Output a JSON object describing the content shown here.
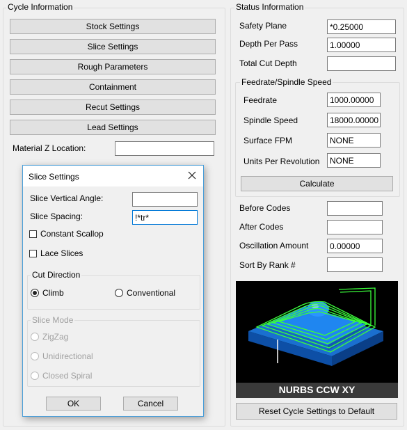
{
  "cycle_info": {
    "title": "Cycle Information",
    "buttons": [
      "Stock Settings",
      "Slice Settings",
      "Rough Parameters",
      "Containment",
      "Recut Settings",
      "Lead Settings"
    ],
    "material_z_label": "Material Z Location:",
    "material_z_value": ""
  },
  "status_info": {
    "title": "Status Information",
    "safety_plane_label": "Safety Plane",
    "safety_plane_value": "*0.25000",
    "depth_per_pass_label": "Depth Per Pass",
    "depth_per_pass_value": "1.00000",
    "total_cut_depth_label": "Total Cut Depth",
    "total_cut_depth_value": "",
    "feed_group": {
      "title": "Feedrate/Spindle Speed",
      "feedrate_label": "Feedrate",
      "feedrate_value": "1000.00000",
      "spindle_label": "Spindle Speed",
      "spindle_value": "18000.00000",
      "sfpm_label": "Surface FPM",
      "sfpm_value": "NONE",
      "upr_label": "Units Per Revolution",
      "upr_value": "NONE",
      "calculate_label": "Calculate"
    },
    "before_codes_label": "Before Codes",
    "before_codes_value": "",
    "after_codes_label": "After Codes",
    "after_codes_value": "",
    "oscillation_label": "Oscillation Amount",
    "oscillation_value": "0.00000",
    "sort_rank_label": "Sort By Rank #",
    "sort_rank_value": "",
    "preview_caption": "NURBS CCW XY",
    "reset_label": "Reset Cycle Settings to Default"
  },
  "dialog": {
    "title": "Slice Settings",
    "vertical_angle_label": "Slice Vertical Angle:",
    "vertical_angle_value": "",
    "spacing_label": "Slice Spacing:",
    "spacing_value": "!*tr*",
    "constant_scallop_label": "Constant Scallop",
    "lace_slices_label": "Lace Slices",
    "cut_direction_title": "Cut Direction",
    "climb_label": "Climb",
    "conventional_label": "Conventional",
    "cut_direction_selected": "Climb",
    "slice_mode_title": "Slice Mode",
    "zigzag_label": "ZigZag",
    "unidirectional_label": "Unidirectional",
    "closed_spiral_label": "Closed Spiral",
    "ok_label": "OK",
    "cancel_label": "Cancel"
  }
}
